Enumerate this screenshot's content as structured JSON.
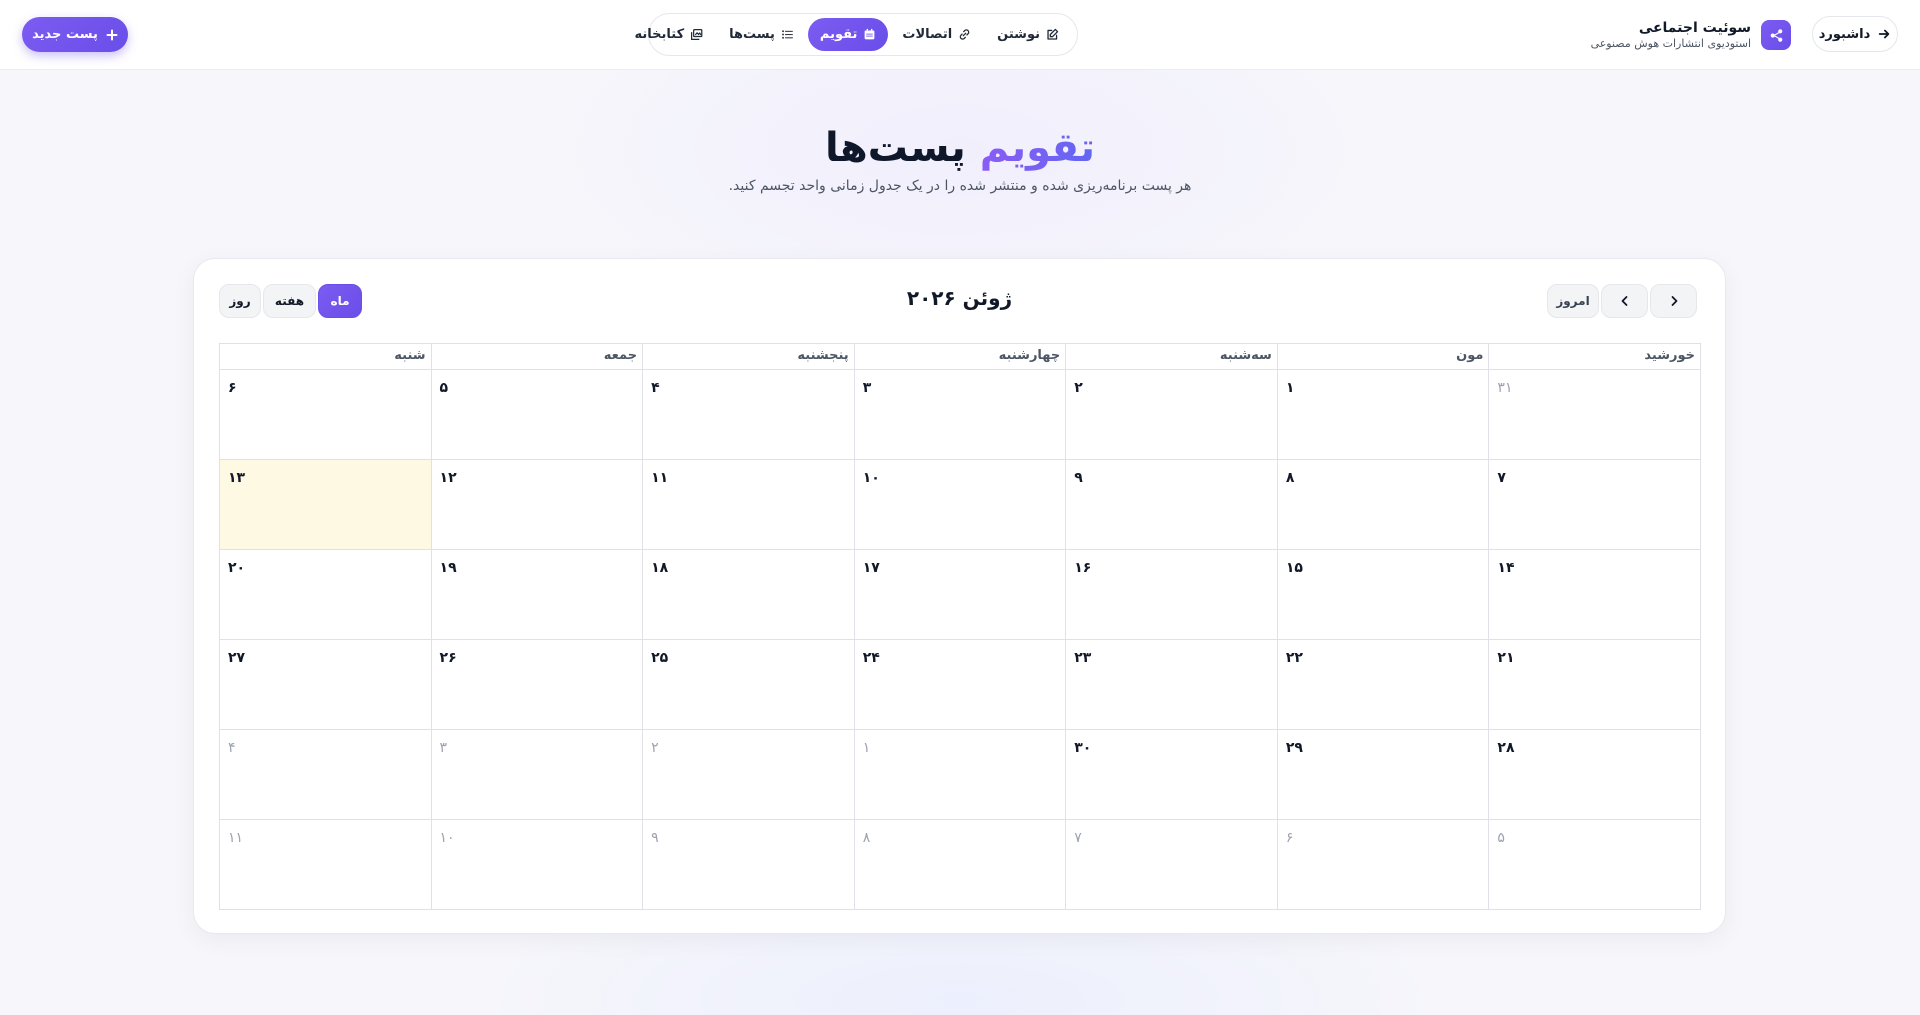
{
  "header": {
    "dashboard_label": "داشبورد",
    "brand_title": "سوئیت اجتماعی",
    "brand_subtitle": "استودیوی انتشارات هوش مصنوعی",
    "new_post_label": "پست جدید",
    "nav": [
      {
        "label": "نوشتن",
        "icon": "edit-icon"
      },
      {
        "label": "اتصالات",
        "icon": "link-icon"
      },
      {
        "label": "تقویم",
        "icon": "calendar-icon",
        "active": true
      },
      {
        "label": "پست‌ها",
        "icon": "list-icon"
      },
      {
        "label": "کتابخانه",
        "icon": "library-icon"
      }
    ]
  },
  "hero": {
    "title_accent": "تقویم",
    "title_rest": "پست‌ها",
    "subtitle": "هر پست برنامه‌ریزی شده و منتشر شده را در یک جدول زمانی واحد تجسم کنید."
  },
  "calendar": {
    "title": "ژوئن ۲۰۲۶",
    "today_label": "امروز",
    "views": {
      "month": "ماه",
      "week": "هفته",
      "day": "روز"
    },
    "active_view": "month",
    "weekdays": [
      "خورشید",
      "مون",
      "سه‌شنبه",
      "چهارشنبه",
      "پنجشنبه",
      "جمعه",
      "شنبه"
    ],
    "weeks": [
      [
        {
          "d": "۳۱",
          "o": true
        },
        {
          "d": "۱"
        },
        {
          "d": "۲"
        },
        {
          "d": "۳"
        },
        {
          "d": "۴"
        },
        {
          "d": "۵"
        },
        {
          "d": "۶"
        }
      ],
      [
        {
          "d": "۷"
        },
        {
          "d": "۸"
        },
        {
          "d": "۹"
        },
        {
          "d": "۱۰"
        },
        {
          "d": "۱۱"
        },
        {
          "d": "۱۲"
        },
        {
          "d": "۱۳",
          "today": true
        }
      ],
      [
        {
          "d": "۱۴"
        },
        {
          "d": "۱۵"
        },
        {
          "d": "۱۶"
        },
        {
          "d": "۱۷"
        },
        {
          "d": "۱۸"
        },
        {
          "d": "۱۹"
        },
        {
          "d": "۲۰"
        }
      ],
      [
        {
          "d": "۲۱"
        },
        {
          "d": "۲۲"
        },
        {
          "d": "۲۳"
        },
        {
          "d": "۲۴"
        },
        {
          "d": "۲۵"
        },
        {
          "d": "۲۶"
        },
        {
          "d": "۲۷"
        }
      ],
      [
        {
          "d": "۲۸"
        },
        {
          "d": "۲۹"
        },
        {
          "d": "۳۰"
        },
        {
          "d": "۱",
          "o": true
        },
        {
          "d": "۲",
          "o": true
        },
        {
          "d": "۳",
          "o": true
        },
        {
          "d": "۴",
          "o": true
        }
      ],
      [
        {
          "d": "۵",
          "o": true
        },
        {
          "d": "۶",
          "o": true
        },
        {
          "d": "۷",
          "o": true
        },
        {
          "d": "۸",
          "o": true
        },
        {
          "d": "۹",
          "o": true
        },
        {
          "d": "۱۰",
          "o": true
        },
        {
          "d": "۱۱",
          "o": true
        }
      ]
    ]
  },
  "colors": {
    "accent": "#6a4ee8",
    "today_bg": "#fef9e2"
  }
}
